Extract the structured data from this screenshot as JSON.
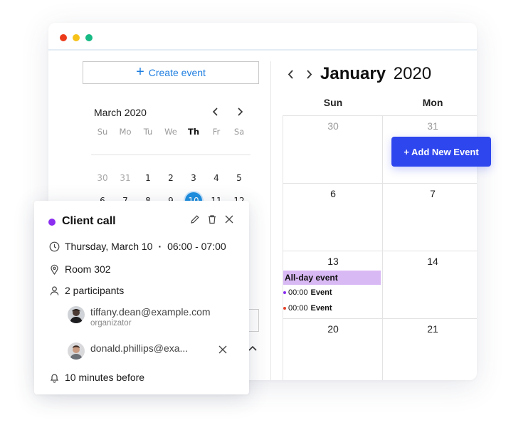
{
  "sidebar": {
    "create_label": "Create event"
  },
  "mini_calendar": {
    "month": "March",
    "year": "2020",
    "weekdays": [
      "Su",
      "Mo",
      "Tu",
      "We",
      "Th",
      "Fr",
      "Sa"
    ],
    "rows": [
      [
        "30",
        "31",
        "1",
        "2",
        "3",
        "4",
        "5"
      ],
      [
        "6",
        "7",
        "8",
        "9",
        "10",
        "11",
        "12"
      ]
    ],
    "selected_day": "10"
  },
  "calendar": {
    "month": "January",
    "year": "2020",
    "columns": [
      "Sun",
      "Mon"
    ],
    "weeks": [
      [
        "30",
        "31"
      ],
      [
        "6",
        "7"
      ],
      [
        "13",
        "14"
      ],
      [
        "20",
        "21"
      ]
    ],
    "add_button_label": "+ Add New Event",
    "allday_event_label": "All-day event",
    "events": [
      {
        "time": "00:00",
        "name": "Event",
        "color": "#8b2ef0"
      },
      {
        "time": "00:00",
        "name": "Event",
        "color": "#e4432b"
      }
    ]
  },
  "popup": {
    "title": "Client call",
    "accent_color": "#8b2ef0",
    "date": "Thursday, March 10",
    "separator": "·",
    "time_range": "06:00 - 07:00",
    "location": "Room 302",
    "participants_label": "2 participants",
    "participants": [
      {
        "email": "tiffany.dean@example.com",
        "role": "organizator"
      },
      {
        "email": "donald.phillips@exa..."
      }
    ],
    "reminder": "10 minutes before"
  },
  "icons": [
    "pencil-icon",
    "trash-icon",
    "close-icon",
    "clock-icon",
    "location-pin-icon",
    "person-icon",
    "bell-icon",
    "chevron-left-icon",
    "chevron-right-icon",
    "chevron-up-icon",
    "plus-icon"
  ]
}
